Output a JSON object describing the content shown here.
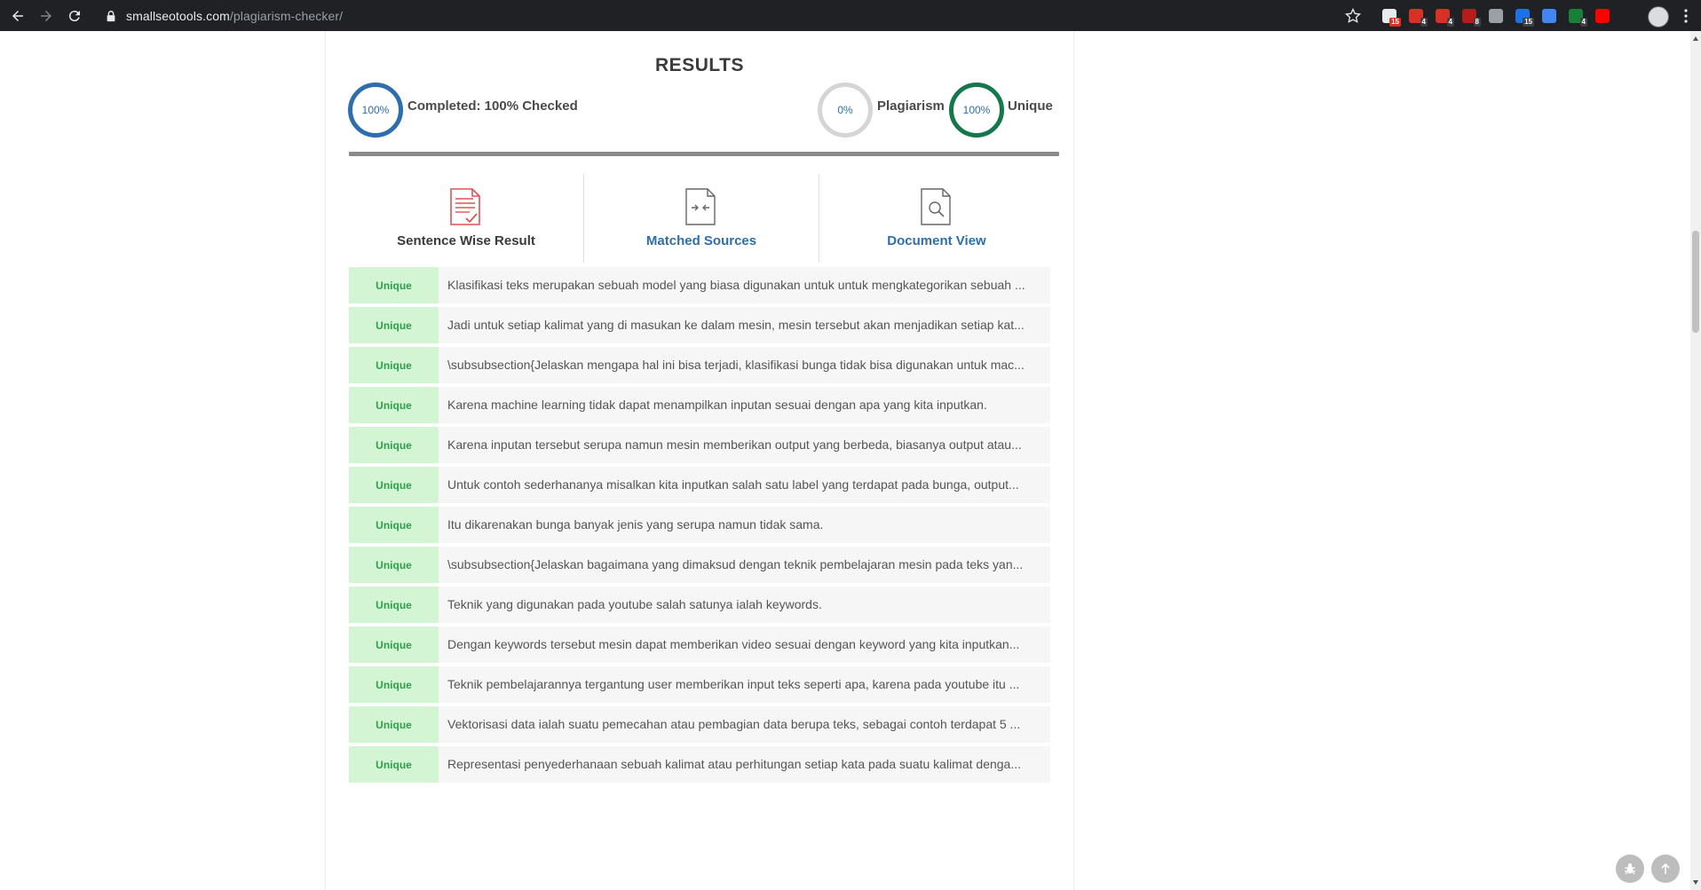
{
  "browser": {
    "url_host": "smallseotools.com",
    "url_path": "/plagiarism-checker/",
    "extensions": [
      {
        "name": "tab-manager-extension",
        "badge": "15",
        "color": "#e8eaed",
        "badge_color": "#d93025"
      },
      {
        "name": "adblock-extension",
        "badge": "4",
        "color": "#d93025",
        "badge_color": "#3c4043"
      },
      {
        "name": "abp-extension",
        "badge": "4",
        "color": "#d93025",
        "badge_color": "#3c4043"
      },
      {
        "name": "ublock-extension",
        "badge": "8",
        "color": "#b71c1c",
        "badge_color": "#3c4043"
      },
      {
        "name": "screenshot-extension",
        "badge": "",
        "color": "#9aa0a6",
        "badge_color": "#3c4043"
      },
      {
        "name": "grammar-extension",
        "badge": "15",
        "color": "#1a73e8",
        "badge_color": "#3c4043"
      },
      {
        "name": "color-picker-extension",
        "badge": "",
        "color": "#4285f4",
        "badge_color": "#3c4043"
      },
      {
        "name": "shield-extension",
        "badge": "4",
        "color": "#188038",
        "badge_color": "#3c4043"
      },
      {
        "name": "youtube-extension",
        "badge": "",
        "color": "#ff0000",
        "badge_color": "#3c4043"
      }
    ]
  },
  "results": {
    "title": "RESULTS",
    "completed_percent": "100%",
    "completed_label": "Completed: 100% Checked",
    "plagiarism_percent": "0%",
    "plagiarism_label": "Plagiarism",
    "unique_percent": "100%",
    "unique_label": "Unique",
    "progress_fraction": 1.0
  },
  "tabs": {
    "sentence_wise": "Sentence Wise Result",
    "matched_sources": "Matched Sources",
    "document_view": "Document View"
  },
  "sentences": [
    {
      "status": "Unique",
      "text": "Klasifikasi teks merupakan sebuah model yang biasa digunakan untuk untuk mengkategorikan sebuah ..."
    },
    {
      "status": "Unique",
      "text": "Jadi untuk setiap kalimat yang di masukan ke dalam mesin, mesin tersebut akan menjadikan setiap kat..."
    },
    {
      "status": "Unique",
      "text": "\\subsubsection{Jelaskan mengapa hal ini bisa terjadi, klasifikasi bunga tidak bisa digunakan untuk mac..."
    },
    {
      "status": "Unique",
      "text": "Karena machine learning tidak dapat menampilkan inputan sesuai dengan apa yang kita inputkan."
    },
    {
      "status": "Unique",
      "text": "Karena inputan tersebut serupa namun mesin memberikan output yang berbeda, biasanya output atau..."
    },
    {
      "status": "Unique",
      "text": "Untuk contoh sederhananya misalkan kita inputkan salah satu label yang terdapat pada bunga, output..."
    },
    {
      "status": "Unique",
      "text": "Itu dikarenakan bunga banyak jenis yang serupa namun tidak sama."
    },
    {
      "status": "Unique",
      "text": "\\subsubsection{Jelaskan bagaimana yang dimaksud dengan teknik pembelajaran mesin pada teks yan..."
    },
    {
      "status": "Unique",
      "text": "Teknik yang digunakan pada youtube salah satunya ialah keywords."
    },
    {
      "status": "Unique",
      "text": "Dengan keywords tersebut mesin dapat memberikan video sesuai dengan keyword yang kita inputkan..."
    },
    {
      "status": "Unique",
      "text": "Teknik pembelajarannya tergantung user memberikan input teks seperti apa, karena pada youtube itu ..."
    },
    {
      "status": "Unique",
      "text": "Vektorisasi data ialah suatu pemecahan atau pembagian data berupa teks, sebagai contoh terdapat 5 ..."
    },
    {
      "status": "Unique",
      "text": "Representasi penyederhanaan sebuah kalimat atau perhitungan setiap kata pada suatu kalimat denga..."
    }
  ]
}
